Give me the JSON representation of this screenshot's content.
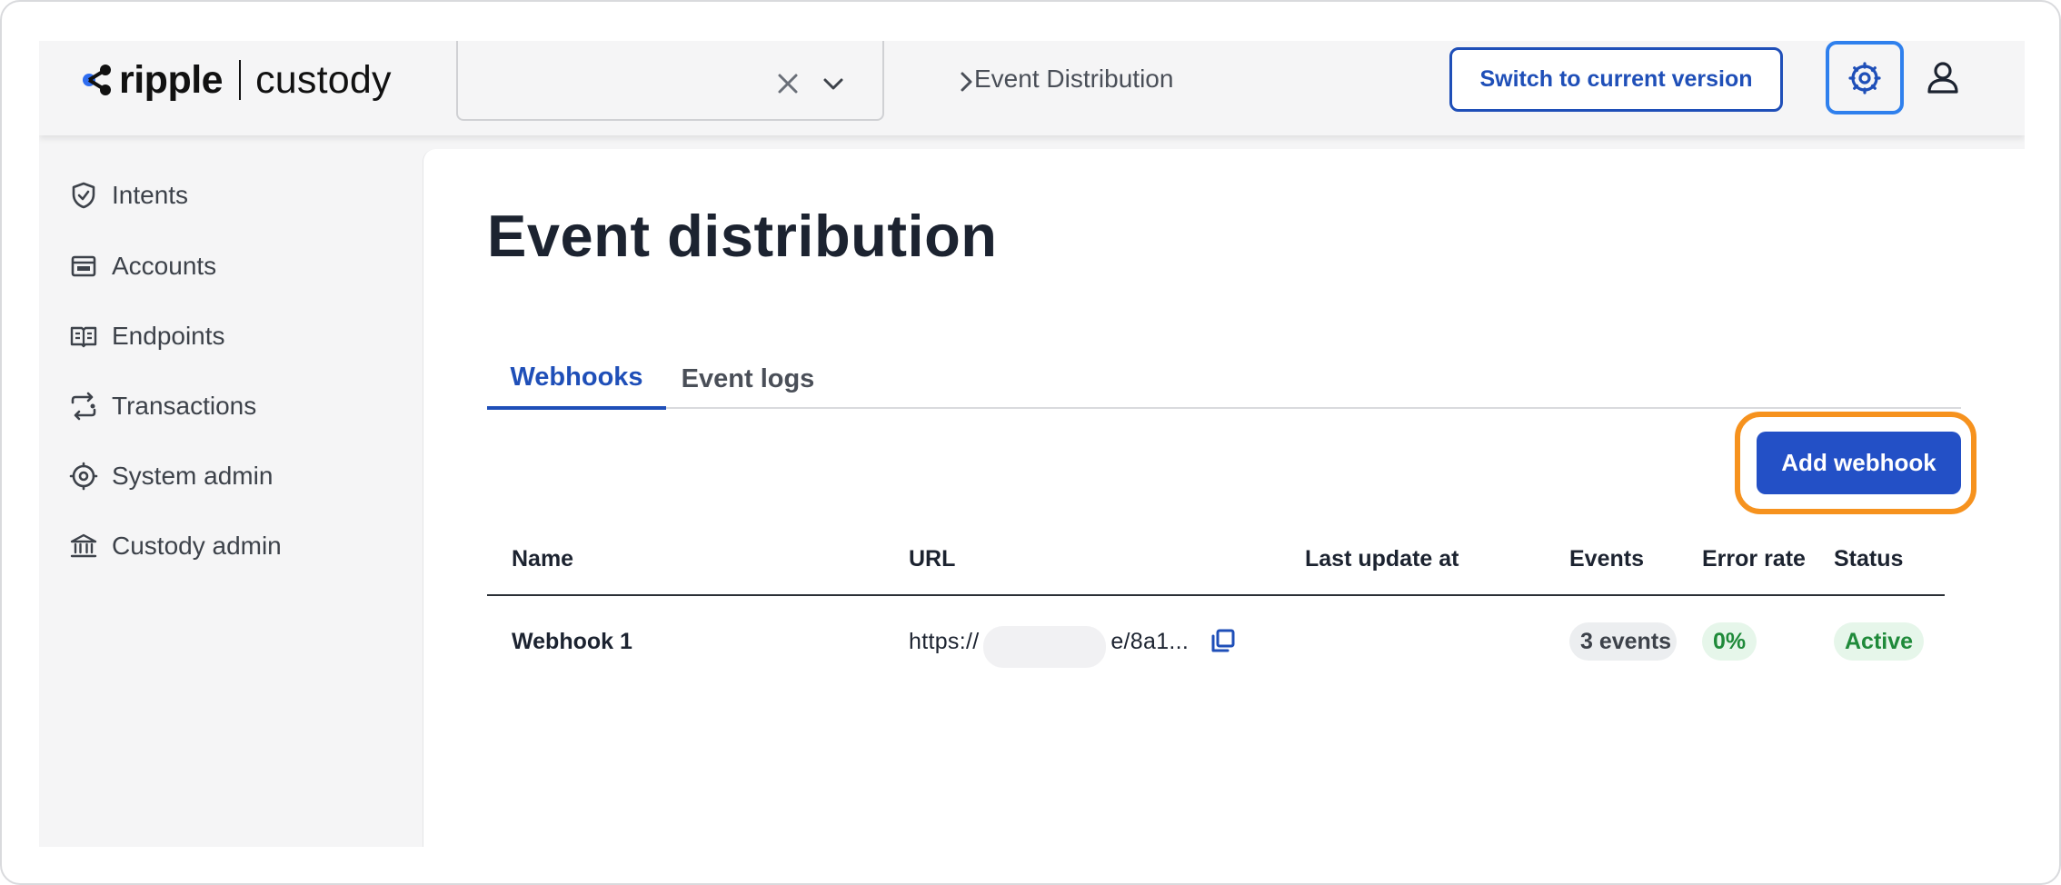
{
  "header": {
    "logo_brand": "ripple",
    "logo_product": "custody",
    "org_select_value": "",
    "breadcrumb_current": "Event Distribution",
    "switch_version_label": "Switch to current version",
    "icons": [
      "ripple-logo-icon",
      "close-icon",
      "chevron-down-icon",
      "chevron-right-icon",
      "gear-icon",
      "user-icon"
    ]
  },
  "sidebar": {
    "items": [
      {
        "label": "Intents",
        "icon": "shield-check-icon"
      },
      {
        "label": "Accounts",
        "icon": "wallet-icon"
      },
      {
        "label": "Endpoints",
        "icon": "book-icon"
      },
      {
        "label": "Transactions",
        "icon": "transfer-icon"
      },
      {
        "label": "System admin",
        "icon": "gear-icon"
      },
      {
        "label": "Custody admin",
        "icon": "bank-icon"
      }
    ]
  },
  "main": {
    "title": "Event distribution",
    "tabs": [
      {
        "label": "Webhooks",
        "active": true
      },
      {
        "label": "Event logs",
        "active": false
      }
    ],
    "add_button_label": "Add webhook",
    "table": {
      "columns": [
        "Name",
        "URL",
        "Last update at",
        "Events",
        "Error rate",
        "Status"
      ],
      "rows": [
        {
          "name": "Webhook 1",
          "url": "https://                    e/8a1...",
          "last_update": "",
          "events": "3 events",
          "error_rate": "0%",
          "status": "Active"
        }
      ]
    }
  },
  "colors": {
    "accent_blue": "#1f4fb8",
    "primary_button": "#2350c6",
    "focus_blue": "#2f80ed",
    "highlight_orange": "#f6921e",
    "status_green": "#1f8a3a",
    "sidebar_bg": "#f5f5f6"
  }
}
